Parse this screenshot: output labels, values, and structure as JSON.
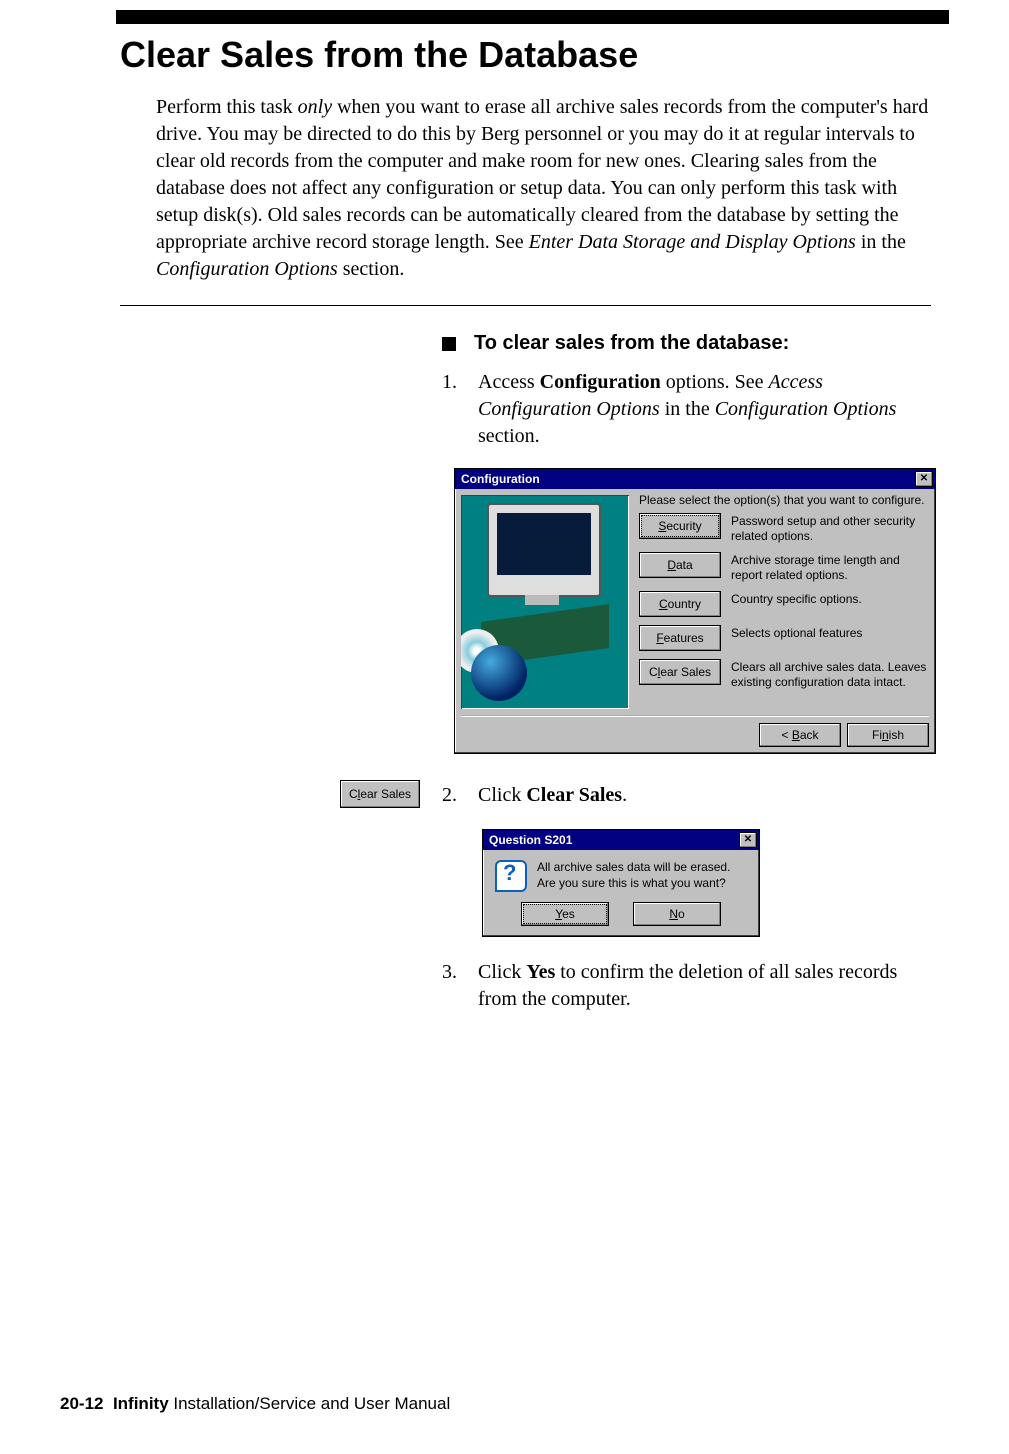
{
  "page": {
    "title": "Clear Sales from the Database",
    "intro_a": "Perform this task ",
    "intro_only": "only",
    "intro_b": " when you want to erase all archive sales records from the computer's hard drive. You may be directed to do this by Berg personnel or you may do it at regular intervals to clear old records from the computer and make room for new ones. Clearing sales from the database does not affect any configuration or setup data. You can only perform this task with setup disk(s). Old sales records can be automatically cleared from the database by setting the appropriate archive record storage length. See ",
    "intro_ref1": "Enter Data Storage and Display Options",
    "intro_c": " in the ",
    "intro_ref2": "Configuration Options",
    "intro_d": " section."
  },
  "task": {
    "heading": "To clear sales from the database:",
    "step1_a": "Access ",
    "step1_bold": "Configuration",
    "step1_b": " options. See ",
    "step1_ital1": "Access Configuration Options",
    "step1_c": " in the ",
    "step1_ital2": "Configuration Options",
    "step1_d": " section.",
    "step2_a": "Click ",
    "step2_bold": "Clear Sales",
    "step2_b": ".",
    "step3_a": "Click ",
    "step3_bold": "Yes",
    "step3_b": " to confirm the deletion of all sales records from the computer.",
    "n1": "1.",
    "n2": "2.",
    "n3": "3."
  },
  "cfg": {
    "title": "Configuration",
    "instr": "Please select the option(s) that you want to configure.",
    "buttons": {
      "security": "Security",
      "data": "Data",
      "country": "Country",
      "features": "Features",
      "clear": "Clear Sales"
    },
    "underline": {
      "security": "S",
      "data": "D",
      "country": "C",
      "features": "F",
      "clear": "l"
    },
    "desc": {
      "security": "Password setup and other security related options.",
      "data": "Archive storage time length and report related options.",
      "country": "Country specific options.",
      "features": "Selects optional features",
      "clear": "Clears all archive sales data.  Leaves existing configuration data intact."
    },
    "back": "< Back",
    "back_u": "B",
    "finish": "Finish",
    "finish_u": "n",
    "close_x": "✕"
  },
  "margin_btn": {
    "label": "Clear Sales",
    "u": "l"
  },
  "q": {
    "title": "Question S201",
    "msg": "All archive sales data will be erased. Are you sure this is what you want?",
    "yes": "Yes",
    "yes_u": "Y",
    "no": "No",
    "no_u": "N",
    "close_x": "✕"
  },
  "footer": {
    "pg": "20-12",
    "book": "Infinity",
    "rest": " Installation/Service and User Manual",
    "sp": "  "
  }
}
